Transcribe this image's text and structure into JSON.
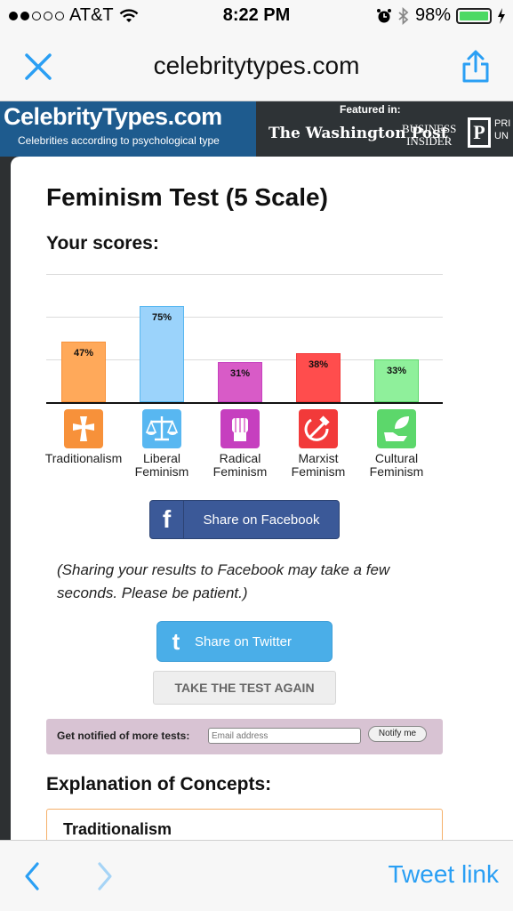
{
  "status_bar": {
    "carrier": "AT&T",
    "time": "8:22 PM",
    "battery": "98%"
  },
  "url_bar": {
    "domain": "celebritytypes.com"
  },
  "site_banner": {
    "logo_title": "CelebrityTypes.com",
    "logo_subtitle": "Celebrities according to psychological type",
    "featured_label": "Featured in:",
    "press": [
      "The Washington Post",
      "BUSINESS",
      "INSIDER",
      "P",
      "PRI",
      "UN"
    ]
  },
  "page": {
    "title": "Feminism Test (5 Scale)",
    "scores_label": "Your scores:"
  },
  "chart_data": {
    "type": "bar",
    "categories": [
      "Traditionalism",
      "Liberal Feminism",
      "Radical Feminism",
      "Marxist Feminism",
      "Cultural Feminism"
    ],
    "values": [
      47,
      75,
      31,
      38,
      33
    ],
    "data_labels": [
      "47%",
      "75%",
      "31%",
      "38%",
      "33%"
    ],
    "category_labels": [
      [
        "Traditionalism"
      ],
      [
        "Liberal",
        "Feminism"
      ],
      [
        "Radical",
        "Feminism"
      ],
      [
        "Marxist",
        "Feminism"
      ],
      [
        "Cultural",
        "Feminism"
      ]
    ],
    "colors": [
      "#f7913a",
      "#58b7f1",
      "#c63fbf",
      "#f23a3a",
      "#5cd76b"
    ],
    "fills": [
      "#ffa95a",
      "#9bd3fb",
      "#d85bc7",
      "#ff4d4d",
      "#8ff09b"
    ],
    "icons": [
      "cross-icon",
      "scales-icon",
      "fist-icon",
      "hammer-sickle-icon",
      "leaf-hand-icon"
    ],
    "ylim": [
      0,
      100
    ],
    "grid": true
  },
  "buttons": {
    "facebook_icon": "f",
    "facebook": "Share on Facebook",
    "sharing_note": "(Sharing your results to Facebook may take a few seconds. Please be patient.)",
    "twitter_icon": "t",
    "twitter": "Share on Twitter",
    "retake": "TAKE THE TEST AGAIN"
  },
  "notify": {
    "label": "Get notified of more tests:",
    "placeholder": "Email address",
    "button": "Notify me"
  },
  "explanation": {
    "title": "Explanation of Concepts:",
    "first_concept": "Traditionalism"
  },
  "toolbar": {
    "tweet_link": "Tweet link"
  }
}
